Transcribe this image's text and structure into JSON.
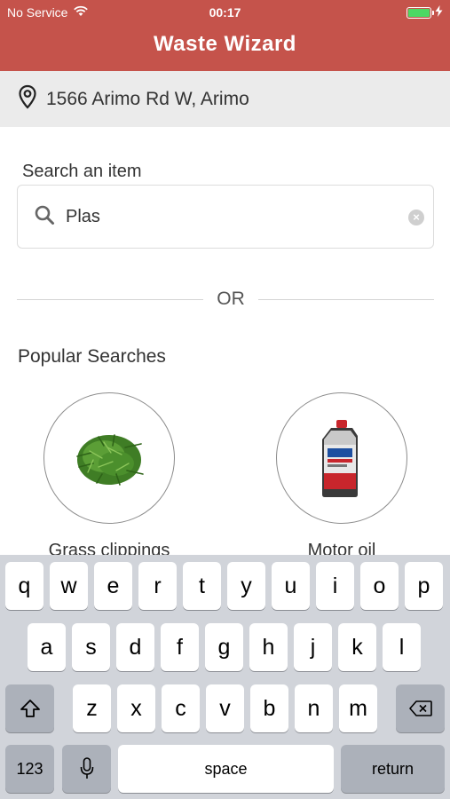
{
  "status_bar": {
    "carrier": "No Service",
    "time": "00:17"
  },
  "header": {
    "title": "Waste Wizard"
  },
  "address": {
    "text": "1566 Arimo Rd W, Arimo"
  },
  "search": {
    "label": "Search an item",
    "value": "Plas"
  },
  "divider": {
    "text": "OR"
  },
  "popular": {
    "title": "Popular Searches",
    "items": [
      {
        "label": "Grass clippings",
        "icon": "grass-image"
      },
      {
        "label": "Motor oil",
        "icon": "motor-oil-bottle-image"
      }
    ]
  },
  "keyboard": {
    "row1": [
      "q",
      "w",
      "e",
      "r",
      "t",
      "y",
      "u",
      "i",
      "o",
      "p"
    ],
    "row2": [
      "a",
      "s",
      "d",
      "f",
      "g",
      "h",
      "j",
      "k",
      "l"
    ],
    "row3": [
      "z",
      "x",
      "c",
      "v",
      "b",
      "n",
      "m"
    ],
    "numbers_label": "123",
    "space_label": "space",
    "return_label": "return"
  },
  "colors": {
    "header": "#c5534b",
    "address_bar": "#ebebeb",
    "keyboard": "#d1d4da",
    "battery": "#4cd964"
  }
}
